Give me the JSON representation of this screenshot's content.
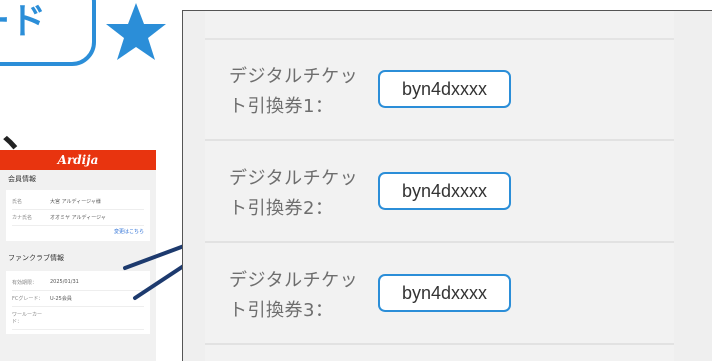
{
  "badge": {
    "text": "ード"
  },
  "punct": "、",
  "phone": {
    "brand": "Ardija",
    "section1": "会員情報",
    "rows1": [
      {
        "k": "氏名",
        "v": "大宮 アルディージャ様"
      },
      {
        "k": "カナ氏名",
        "v": "オオミヤ アルディージャ"
      }
    ],
    "link": "変更はこちら",
    "section2": "ファンクラブ情報",
    "rows2": [
      {
        "k": "有効期限：",
        "v": "2025/01/31"
      },
      {
        "k": "FCグレード：",
        "v": "U-25会員"
      },
      {
        "k": "ワールーカード：",
        "v": ""
      }
    ]
  },
  "tickets": [
    {
      "label": "デジタルチケット引換券1：",
      "code": "byn4dxxxx"
    },
    {
      "label": "デジタルチケット引換券2：",
      "code": "byn4dxxxx"
    },
    {
      "label": "デジタルチケット引換券3：",
      "code": "byn4dxxxx"
    }
  ]
}
